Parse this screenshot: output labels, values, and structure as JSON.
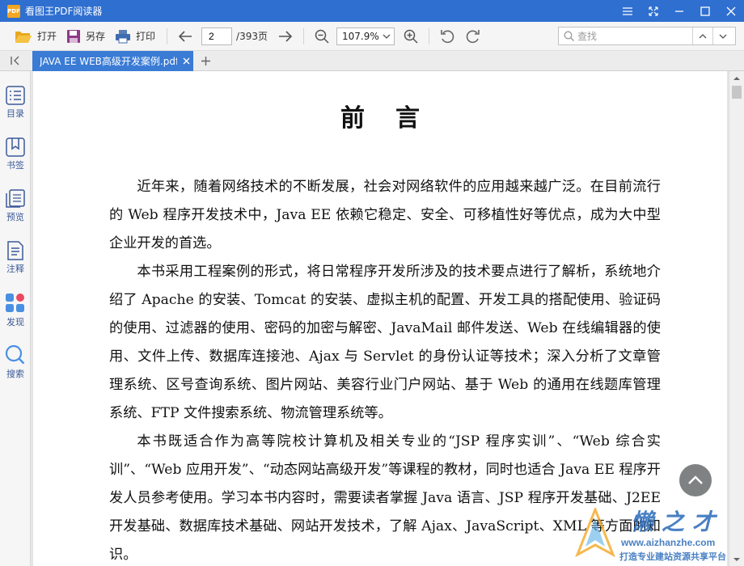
{
  "app": {
    "title": "看图王PDF阅读器",
    "logo_text": "PDF"
  },
  "toolbar": {
    "open_label": "打开",
    "saveas_label": "另存",
    "print_label": "打印",
    "current_page": "2",
    "page_total": "/393页",
    "zoom": "107.9%",
    "search_placeholder": "查找"
  },
  "tabs": [
    {
      "label": "JAVA EE WEB高级开发案例.pdf",
      "active": true
    }
  ],
  "sidebar": {
    "items": [
      {
        "label": "目录",
        "icon": "list-icon"
      },
      {
        "label": "书签",
        "icon": "bookmark-icon"
      },
      {
        "label": "预览",
        "icon": "pages-icon"
      },
      {
        "label": "注释",
        "icon": "note-icon"
      },
      {
        "label": "发现",
        "icon": "discover-icon"
      },
      {
        "label": "搜索",
        "icon": "search-icon"
      }
    ]
  },
  "document": {
    "title": "前言",
    "paragraphs": [
      "近年来，随着网络技术的不断发展，社会对网络软件的应用越来越广泛。在目前流行的 Web 程序开发技术中，Java EE 依赖它稳定、安全、可移植性好等优点，成为大中型企业开发的首选。",
      "本书采用工程案例的形式，将日常程序开发所涉及的技术要点进行了解析，系统地介绍了 Apache 的安装、Tomcat 的安装、虚拟主机的配置、开发工具的搭配使用、验证码的使用、过滤器的使用、密码的加密与解密、JavaMail 邮件发送、Web 在线编辑器的使用、文件上传、数据库连接池、Ajax 与 Servlet 的身份认证等技术；深入分析了文章管理系统、区号查询系统、图片网站、美容行业门户网站、基于 Web 的通用在线题库管理系统、FTP 文件搜索系统、物流管理系统等。",
      "本书既适合作为高等院校计算机及相关专业的“JSP 程序实训”、“Web 综合实训”、“Web 应用开发”、“动态网站高级开发”等课程的教材，同时也适合 Java EE 程序开发人员参考使用。学习本书内容时，需要读者掌握 Java 语言、JSP 程序开发基础、J2EE 开发基础、数据库技术基础、网站开发技术，了解 Ajax、JavaScript、XML 等方面的知识。"
    ]
  },
  "watermark": {
    "brand": "懒之才",
    "url": "www.aizhanzhe.com",
    "slogan": "打造专业建站资源共享平台"
  },
  "colors": {
    "titlebar": "#2f6fd0",
    "tab_active": "#3a7bd5",
    "sidebar_label": "#3b5998"
  }
}
